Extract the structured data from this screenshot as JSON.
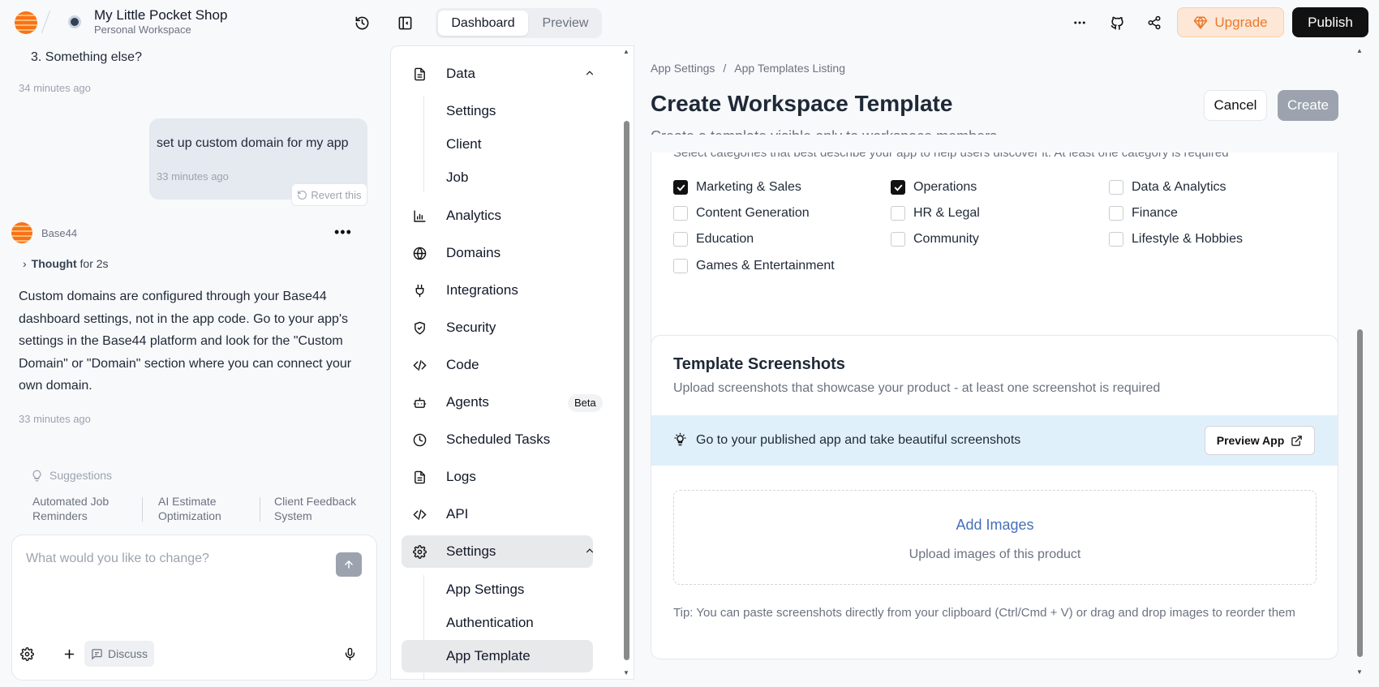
{
  "header": {
    "project_title": "My Little Pocket Shop",
    "project_subtitle": "Personal Workspace",
    "tabs": [
      "Dashboard",
      "Preview"
    ],
    "active_tab": "Dashboard",
    "upgrade_label": "Upgrade",
    "publish_label": "Publish"
  },
  "chat": {
    "prev_item": "3. Something else?",
    "prev_time": "34 minutes ago",
    "user_message": "set up custom domain for my app",
    "user_time": "33 minutes ago",
    "revert_label": "Revert this",
    "bot_name": "Base44",
    "thought_prefix": "Thought",
    "thought_suffix": "for 2s",
    "bot_message": "Custom domains are configured through your Base44 dashboard settings, not in the app code. Go to your app's settings in the Base44 platform and look for the \"Custom Domain\" or \"Domain\" section where you can connect your own domain.",
    "bot_time": "33 minutes ago",
    "suggestions_label": "Suggestions",
    "suggestions": [
      "Automated Job Reminders",
      "AI Estimate Optimization",
      "Client Feedback System"
    ],
    "input_placeholder": "What would you like to change?",
    "discuss_label": "Discuss"
  },
  "nav": {
    "data_label": "Data",
    "data_sub": [
      "Settings",
      "Client",
      "Job"
    ],
    "items": [
      {
        "label": "Analytics",
        "icon": "bar-chart-icon"
      },
      {
        "label": "Domains",
        "icon": "globe-icon"
      },
      {
        "label": "Integrations",
        "icon": "plug-icon"
      },
      {
        "label": "Security",
        "icon": "shield-icon"
      },
      {
        "label": "Code",
        "icon": "code-icon"
      },
      {
        "label": "Agents",
        "icon": "bot-icon",
        "badge": "Beta"
      },
      {
        "label": "Scheduled Tasks",
        "icon": "clock-icon"
      },
      {
        "label": "Logs",
        "icon": "file-icon"
      },
      {
        "label": "API",
        "icon": "code-icon"
      }
    ],
    "settings_label": "Settings",
    "settings_sub": [
      "App Settings",
      "Authentication",
      "App Template"
    ],
    "active_sub": "App Template"
  },
  "main": {
    "breadcrumb": [
      "App Settings",
      "App Templates Listing"
    ],
    "breadcrumb_sep": "/",
    "title": "Create Workspace Template",
    "subtitle": "Create a template visible only to workspace members",
    "cancel_label": "Cancel",
    "create_label": "Create",
    "categories_hint": "Select categories that best describe your app to help users discover it. At least one category is required",
    "categories": [
      {
        "label": "Marketing & Sales",
        "checked": true
      },
      {
        "label": "Operations",
        "checked": true
      },
      {
        "label": "Data & Analytics",
        "checked": false
      },
      {
        "label": "Content Generation",
        "checked": false
      },
      {
        "label": "HR & Legal",
        "checked": false
      },
      {
        "label": "Finance",
        "checked": false
      },
      {
        "label": "Education",
        "checked": false
      },
      {
        "label": "Community",
        "checked": false
      },
      {
        "label": "Lifestyle & Hobbies",
        "checked": false
      },
      {
        "label": "Games & Entertainment",
        "checked": false
      }
    ],
    "screens_title": "Template Screenshots",
    "screens_desc": "Upload screenshots that showcase your product - at least one screenshot is required",
    "tip_bar_text": "Go to your published app and take beautiful screenshots",
    "preview_app_label": "Preview App",
    "add_images_label": "Add Images",
    "upload_hint": "Upload images of this product",
    "tip_text": "Tip: You can paste screenshots directly from your clipboard (Ctrl/Cmd + V) or drag and drop images to reorder them"
  },
  "colors": {
    "accent_orange": "#f97316",
    "upgrade_bg": "#fde7d7",
    "tip_bar_bg": "#e0f0fb",
    "link_blue": "#4670b8"
  }
}
